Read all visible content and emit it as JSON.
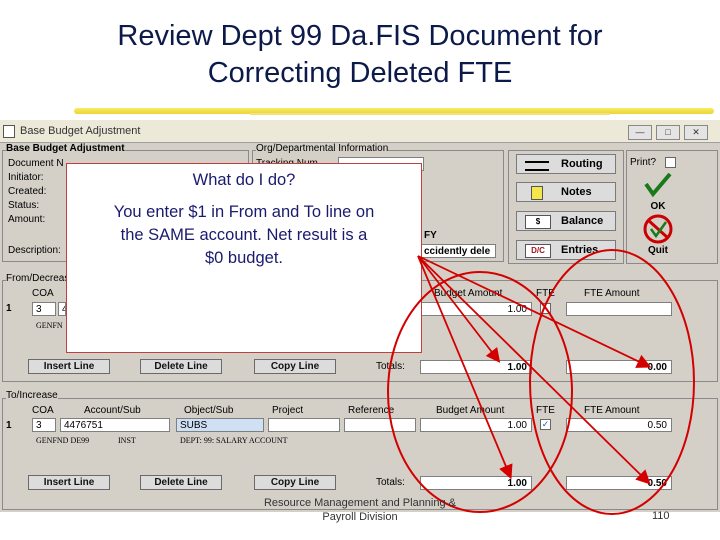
{
  "slide": {
    "title_line1": "Review Dept 99 Da.FIS Document for",
    "title_line2": "Correcting Deleted FTE",
    "footer_line1": "Resource Management and Planning &",
    "footer_line2": "Payroll Division",
    "page_number": "110"
  },
  "window": {
    "title": "Base Budget Adjustment",
    "min": "—",
    "max": "□",
    "close": "✕"
  },
  "header": {
    "group_title": "Base Budget Adjustment",
    "document_label": "Document N",
    "initiator_label": "Initiator:",
    "created_label": "Created:",
    "status_label": "Status:",
    "amount_label": "Amount:",
    "description_label": "Description:",
    "org_group_title": "Org/Departmental Information",
    "org_tracking_label": "Tracking Num",
    "fy_label": "FY",
    "description_value": "ccidently dele"
  },
  "nav": {
    "routing": "Routing",
    "notes": "Notes",
    "balance": "Balance",
    "entries": "Entries",
    "balance_icon": "$",
    "entries_icon": "D/C",
    "print_label": "Print?",
    "ok": "OK",
    "quit": "Quit"
  },
  "from": {
    "group_title": "From/Decrease",
    "headers": {
      "coa": "COA",
      "budget_amount": "Budget Amount",
      "fte": "FTE",
      "fte_amount": "FTE Amount"
    },
    "row_num": "1",
    "coa": "3",
    "account_partial": "4",
    "budget_amount": "1.00",
    "note": "GENFN",
    "insert": "Insert Line",
    "delete": "Delete Line",
    "copy": "Copy Line",
    "totals_label": "Totals:",
    "total_budget": "1.00",
    "total_fte": "0.00"
  },
  "to": {
    "group_title": "To/Increase",
    "headers": {
      "coa": "COA",
      "account_sub": "Account/Sub",
      "object_sub": "Object/Sub",
      "project": "Project",
      "reference": "Reference",
      "budget_amount": "Budget Amount",
      "fte": "FTE",
      "fte_amount": "FTE Amount"
    },
    "row_num": "1",
    "coa": "3",
    "account": "4476751",
    "object": "SUBS",
    "budget_amount": "1.00",
    "fte_check": "✓",
    "fte_amount": "0.50",
    "note_fund": "GENFND DE99",
    "note_inst": "INST",
    "note_dept": "DEPT: 99: SALARY ACCOUNT",
    "insert": "Insert Line",
    "delete": "Delete Line",
    "copy": "Copy Line",
    "totals_label": "Totals:",
    "total_budget": "1.00",
    "total_fte": "0.50"
  },
  "popup": {
    "question": "What do I do?",
    "answer_line1": "You enter $1 in From and To line on",
    "answer_line2": "the SAME account. Net result is a",
    "answer_line3": "$0 budget."
  },
  "colors": {
    "annotation": "#d40000",
    "app_bg": "#d4d0c8",
    "title_text": "#0c1a4a",
    "popup_text": "#1a1a6e"
  }
}
